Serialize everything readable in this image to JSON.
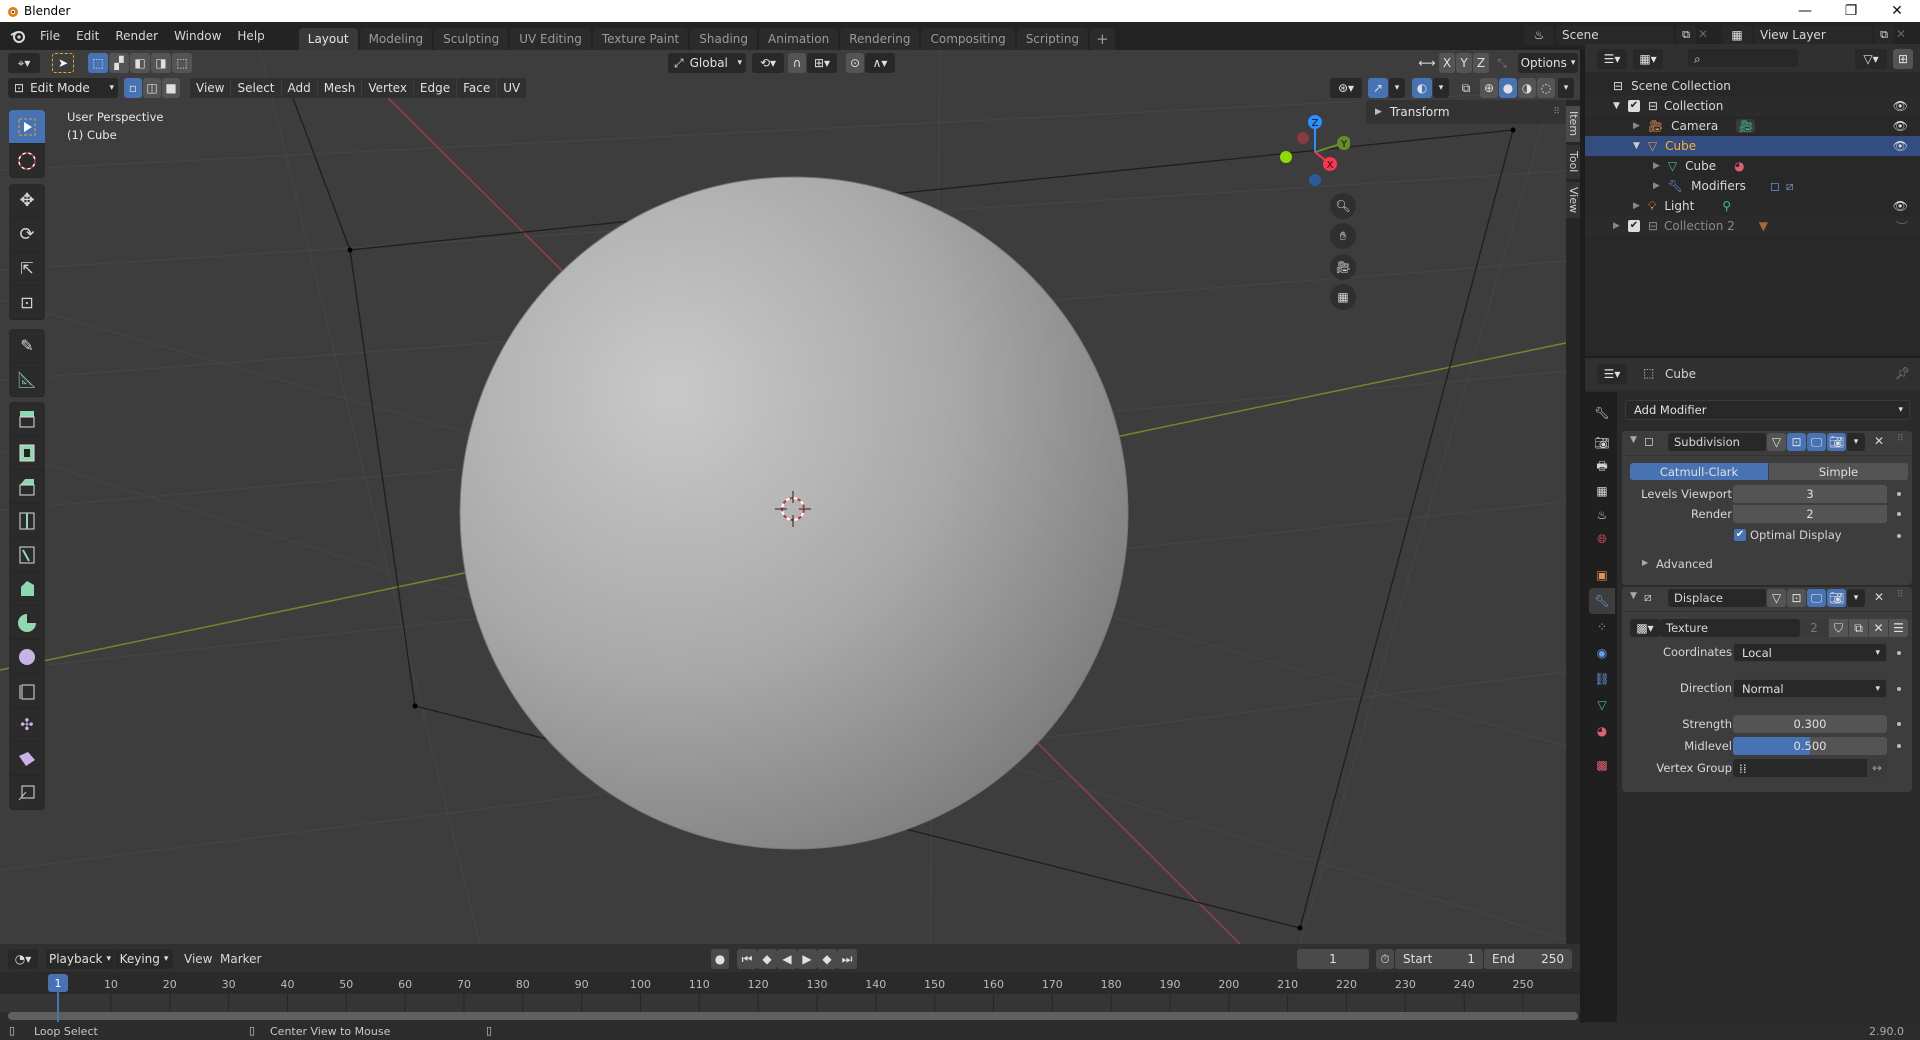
{
  "window": {
    "title": "Blender",
    "minimize": "—",
    "maximize": "❐",
    "close": "✕"
  },
  "topbar": {
    "menus": [
      "File",
      "Edit",
      "Render",
      "Window",
      "Help"
    ],
    "workspaces": [
      "Layout",
      "Modeling",
      "Sculpting",
      "UV Editing",
      "Texture Paint",
      "Shading",
      "Animation",
      "Rendering",
      "Compositing",
      "Scripting"
    ],
    "active_workspace": "Layout",
    "add_workspace": "+",
    "scene": "Scene",
    "view_layer": "View Layer"
  },
  "viewport": {
    "mode": "Edit Mode",
    "menus": [
      "View",
      "Select",
      "Add",
      "Mesh",
      "Vertex",
      "Edge",
      "Face",
      "UV"
    ],
    "orientation": "Global",
    "axes": [
      "X",
      "Y",
      "Z"
    ],
    "options_label": "Options",
    "overlay_title": "User Perspective",
    "overlay_object": "(1) Cube",
    "transform_panel": "Transform",
    "sidebar_tabs": [
      "Item",
      "Tool",
      "View"
    ],
    "gizmo": {
      "x": "X",
      "y": "Y",
      "z": "Z"
    },
    "tools": [
      "select-box",
      "cursor",
      "move",
      "rotate",
      "scale",
      "transform",
      "annotate",
      "measure",
      "extrude-region",
      "inset-faces",
      "bevel",
      "loop-cut",
      "knife",
      "poly-build",
      "spin",
      "smooth",
      "edge-slide",
      "shrink-fatten",
      "shear",
      "rip-region"
    ]
  },
  "outliner": {
    "root": "Scene Collection",
    "items": [
      {
        "label": "Collection",
        "depth": 1,
        "icon": "collection",
        "expanded": true,
        "checked": true,
        "visible": true
      },
      {
        "label": "Camera",
        "depth": 2,
        "icon": "camera-object",
        "extra": "camera-data",
        "visible": true
      },
      {
        "label": "Cube",
        "depth": 2,
        "icon": "mesh-object",
        "selected": true,
        "visible": true
      },
      {
        "label": "Cube",
        "depth": 3,
        "icon": "mesh-data",
        "extra": "material"
      },
      {
        "label": "Modifiers",
        "depth": 3,
        "icon": "wrench",
        "extra": "modifier-icons"
      },
      {
        "label": "Light",
        "depth": 2,
        "icon": "light-object",
        "extra": "light-data",
        "visible": true
      },
      {
        "label": "Collection 2",
        "depth": 1,
        "icon": "collection",
        "checked": true,
        "dimmed": true
      }
    ]
  },
  "properties": {
    "object_name": "Cube",
    "add_modifier": "Add Modifier",
    "subdivision": {
      "name": "Subdivision",
      "algorithms": [
        "Catmull-Clark",
        "Simple"
      ],
      "active_algorithm": "Catmull-Clark",
      "levels_viewport_label": "Levels Viewport",
      "levels_viewport": "3",
      "render_label": "Render",
      "render": "2",
      "optimal_display_label": "Optimal Display",
      "optimal_display": true,
      "advanced_label": "Advanced"
    },
    "displace": {
      "name": "Displace",
      "texture_label": "Texture",
      "texture_users": "2",
      "coordinates_label": "Coordinates",
      "coordinates": "Local",
      "direction_label": "Direction",
      "direction": "Normal",
      "strength_label": "Strength",
      "strength": "0.300",
      "midlevel_label": "Midlevel",
      "midlevel": "0.500",
      "midlevel_fraction": 0.5,
      "vertex_group_label": "Vertex Group",
      "vertex_group": ""
    }
  },
  "timeline": {
    "menus": [
      "Playback",
      "Keying",
      "View",
      "Marker"
    ],
    "current_frame": "1",
    "start_label": "Start",
    "start": "1",
    "end_label": "End",
    "end": "250",
    "ticks": [
      "10",
      "20",
      "30",
      "40",
      "50",
      "60",
      "70",
      "80",
      "90",
      "100",
      "110",
      "120",
      "130",
      "140",
      "150",
      "160",
      "170",
      "180",
      "190",
      "200",
      "210",
      "220",
      "230",
      "240",
      "250"
    ],
    "playhead": "1"
  },
  "statusbar": {
    "left_hint": "Loop Select",
    "middle_hint": "Center View to Mouse",
    "version": "2.90.0"
  },
  "colors": {
    "accent": "#4772b3",
    "selected_text": "#ffaf29",
    "x_axis": "#ff3352",
    "y_axis": "#8bdc00",
    "z_axis": "#2890ff"
  }
}
